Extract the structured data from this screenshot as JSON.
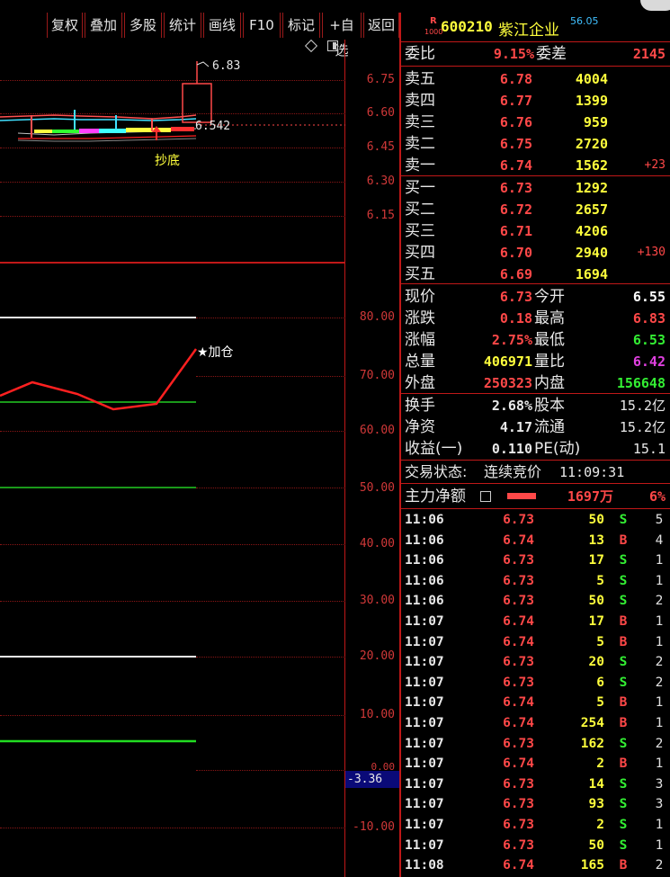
{
  "toolbar": {
    "buttons": [
      "复权",
      "叠加",
      "多股",
      "统计",
      "画线",
      "F10",
      "标记",
      "+自选",
      "返回"
    ]
  },
  "stock": {
    "badge_top": "R",
    "badge_bottom": "1000",
    "code": "600210",
    "name": "紫江企业",
    "superscript": "56.05"
  },
  "price_chart": {
    "y_ticks": [
      "6.75",
      "6.60",
      "6.45",
      "6.30",
      "6.15"
    ],
    "high_label": "6.83",
    "current_label": "6.542",
    "signal_label": "抄底"
  },
  "indicator_chart": {
    "y_ticks": [
      "80.00",
      "70.00",
      "60.00",
      "50.00",
      "40.00",
      "30.00",
      "20.00",
      "10.00",
      "0.00",
      "-10.00"
    ],
    "current_value": "-3.36",
    "signal_label": "★加仓"
  },
  "order_book": {
    "weibi_label": "委比",
    "weibi_value": "9.15%",
    "weicha_label": "委差",
    "weicha_value": "2145",
    "asks": [
      {
        "label": "卖五",
        "price": "6.78",
        "volume": "4004",
        "change": ""
      },
      {
        "label": "卖四",
        "price": "6.77",
        "volume": "1399",
        "change": ""
      },
      {
        "label": "卖三",
        "price": "6.76",
        "volume": "959",
        "change": ""
      },
      {
        "label": "卖二",
        "price": "6.75",
        "volume": "2720",
        "change": ""
      },
      {
        "label": "卖一",
        "price": "6.74",
        "volume": "1562",
        "change": "+23"
      }
    ],
    "bids": [
      {
        "label": "买一",
        "price": "6.73",
        "volume": "1292",
        "change": ""
      },
      {
        "label": "买二",
        "price": "6.72",
        "volume": "2657",
        "change": ""
      },
      {
        "label": "买三",
        "price": "6.71",
        "volume": "4206",
        "change": ""
      },
      {
        "label": "买四",
        "price": "6.70",
        "volume": "2940",
        "change": "+130"
      },
      {
        "label": "买五",
        "price": "6.69",
        "volume": "1694",
        "change": ""
      }
    ]
  },
  "stats": [
    {
      "l1": "现价",
      "v1": "6.73",
      "c1": "#ff4848",
      "l2": "今开",
      "v2": "6.55",
      "c2": "#ffffff"
    },
    {
      "l1": "涨跌",
      "v1": "0.18",
      "c1": "#ff4848",
      "l2": "最高",
      "v2": "6.83",
      "c2": "#ff4848"
    },
    {
      "l1": "涨幅",
      "v1": "2.75%",
      "c1": "#ff4848",
      "l2": "最低",
      "v2": "6.53",
      "c2": "#33ee33"
    },
    {
      "l1": "总量",
      "v1": "406971",
      "c1": "#ffff3c",
      "l2": "量比",
      "v2": "6.42",
      "c2": "#e040e0"
    },
    {
      "l1": "外盘",
      "v1": "250323",
      "c1": "#ff4848",
      "l2": "内盘",
      "v2": "156648",
      "c2": "#33ee33"
    }
  ],
  "fundamentals": [
    {
      "l1": "换手",
      "v1": "2.68%",
      "l2": "股本",
      "v2": "15.2亿"
    },
    {
      "l1": "净资",
      "v1": "4.17",
      "l2": "流通",
      "v2": "15.2亿"
    },
    {
      "l1": "收益(一)",
      "v1": "0.110",
      "l2": "PE(动)",
      "v2": "15.1"
    }
  ],
  "trade_status": {
    "label": "交易状态:",
    "value": "连续竞价",
    "time": "11:09:31"
  },
  "main_force": {
    "label": "主力净额",
    "amount": "1697万",
    "percent": "6%"
  },
  "trades": [
    {
      "time": "11:06",
      "price": "6.73",
      "vol": "50",
      "bs": "S",
      "cnt": "5"
    },
    {
      "time": "11:06",
      "price": "6.74",
      "vol": "13",
      "bs": "B",
      "cnt": "4"
    },
    {
      "time": "11:06",
      "price": "6.73",
      "vol": "17",
      "bs": "S",
      "cnt": "1"
    },
    {
      "time": "11:06",
      "price": "6.73",
      "vol": "5",
      "bs": "S",
      "cnt": "1"
    },
    {
      "time": "11:06",
      "price": "6.73",
      "vol": "50",
      "bs": "S",
      "cnt": "2"
    },
    {
      "time": "11:07",
      "price": "6.74",
      "vol": "17",
      "bs": "B",
      "cnt": "1"
    },
    {
      "time": "11:07",
      "price": "6.74",
      "vol": "5",
      "bs": "B",
      "cnt": "1"
    },
    {
      "time": "11:07",
      "price": "6.73",
      "vol": "20",
      "bs": "S",
      "cnt": "2"
    },
    {
      "time": "11:07",
      "price": "6.73",
      "vol": "6",
      "bs": "S",
      "cnt": "2"
    },
    {
      "time": "11:07",
      "price": "6.74",
      "vol": "5",
      "bs": "B",
      "cnt": "1"
    },
    {
      "time": "11:07",
      "price": "6.74",
      "vol": "254",
      "bs": "B",
      "cnt": "1"
    },
    {
      "time": "11:07",
      "price": "6.73",
      "vol": "162",
      "bs": "S",
      "cnt": "2"
    },
    {
      "time": "11:07",
      "price": "6.74",
      "vol": "2",
      "bs": "B",
      "cnt": "1"
    },
    {
      "time": "11:07",
      "price": "6.73",
      "vol": "14",
      "bs": "S",
      "cnt": "3"
    },
    {
      "time": "11:07",
      "price": "6.73",
      "vol": "93",
      "bs": "S",
      "cnt": "3"
    },
    {
      "time": "11:07",
      "price": "6.73",
      "vol": "2",
      "bs": "S",
      "cnt": "1"
    },
    {
      "time": "11:07",
      "price": "6.73",
      "vol": "50",
      "bs": "S",
      "cnt": "1"
    },
    {
      "time": "11:08",
      "price": "6.74",
      "vol": "165",
      "bs": "B",
      "cnt": "2"
    }
  ],
  "colors": {
    "up": "#ff4848",
    "down": "#33ee33",
    "volume": "#ffff3c",
    "border": "#c01818"
  }
}
